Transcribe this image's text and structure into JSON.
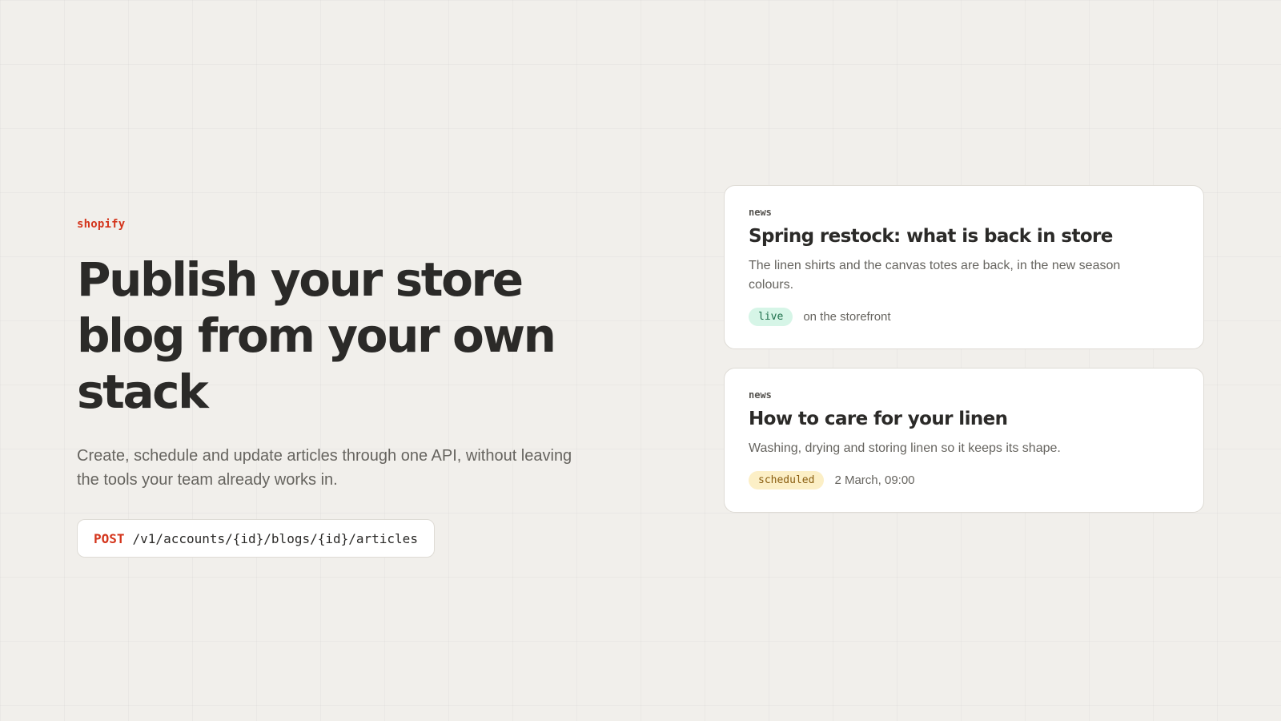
{
  "hero": {
    "brand": "shopify",
    "headline": "Publish your store blog from your own stack",
    "subtitle": "Create, schedule and update articles through one API, without leaving the tools your team already works in.",
    "endpoint": {
      "method": "POST",
      "path": "/v1/accounts/{id}/blogs/{id}/articles"
    }
  },
  "articles": [
    {
      "tag": "news",
      "title": "Spring restock: what is back in store",
      "description": "The linen shirts and the canvas totes are back, in the new season colours.",
      "status": "live",
      "status_detail": "on the storefront"
    },
    {
      "tag": "news",
      "title": "How to care for your linen",
      "description": "Washing, drying and storing linen so it keeps its shape.",
      "status": "scheduled",
      "status_detail": "2 March, 09:00"
    }
  ],
  "colors": {
    "accent": "#d4351c",
    "background": "#f1efeb",
    "live_badge_bg": "#d6f5e7",
    "scheduled_badge_bg": "#fcefc6"
  }
}
